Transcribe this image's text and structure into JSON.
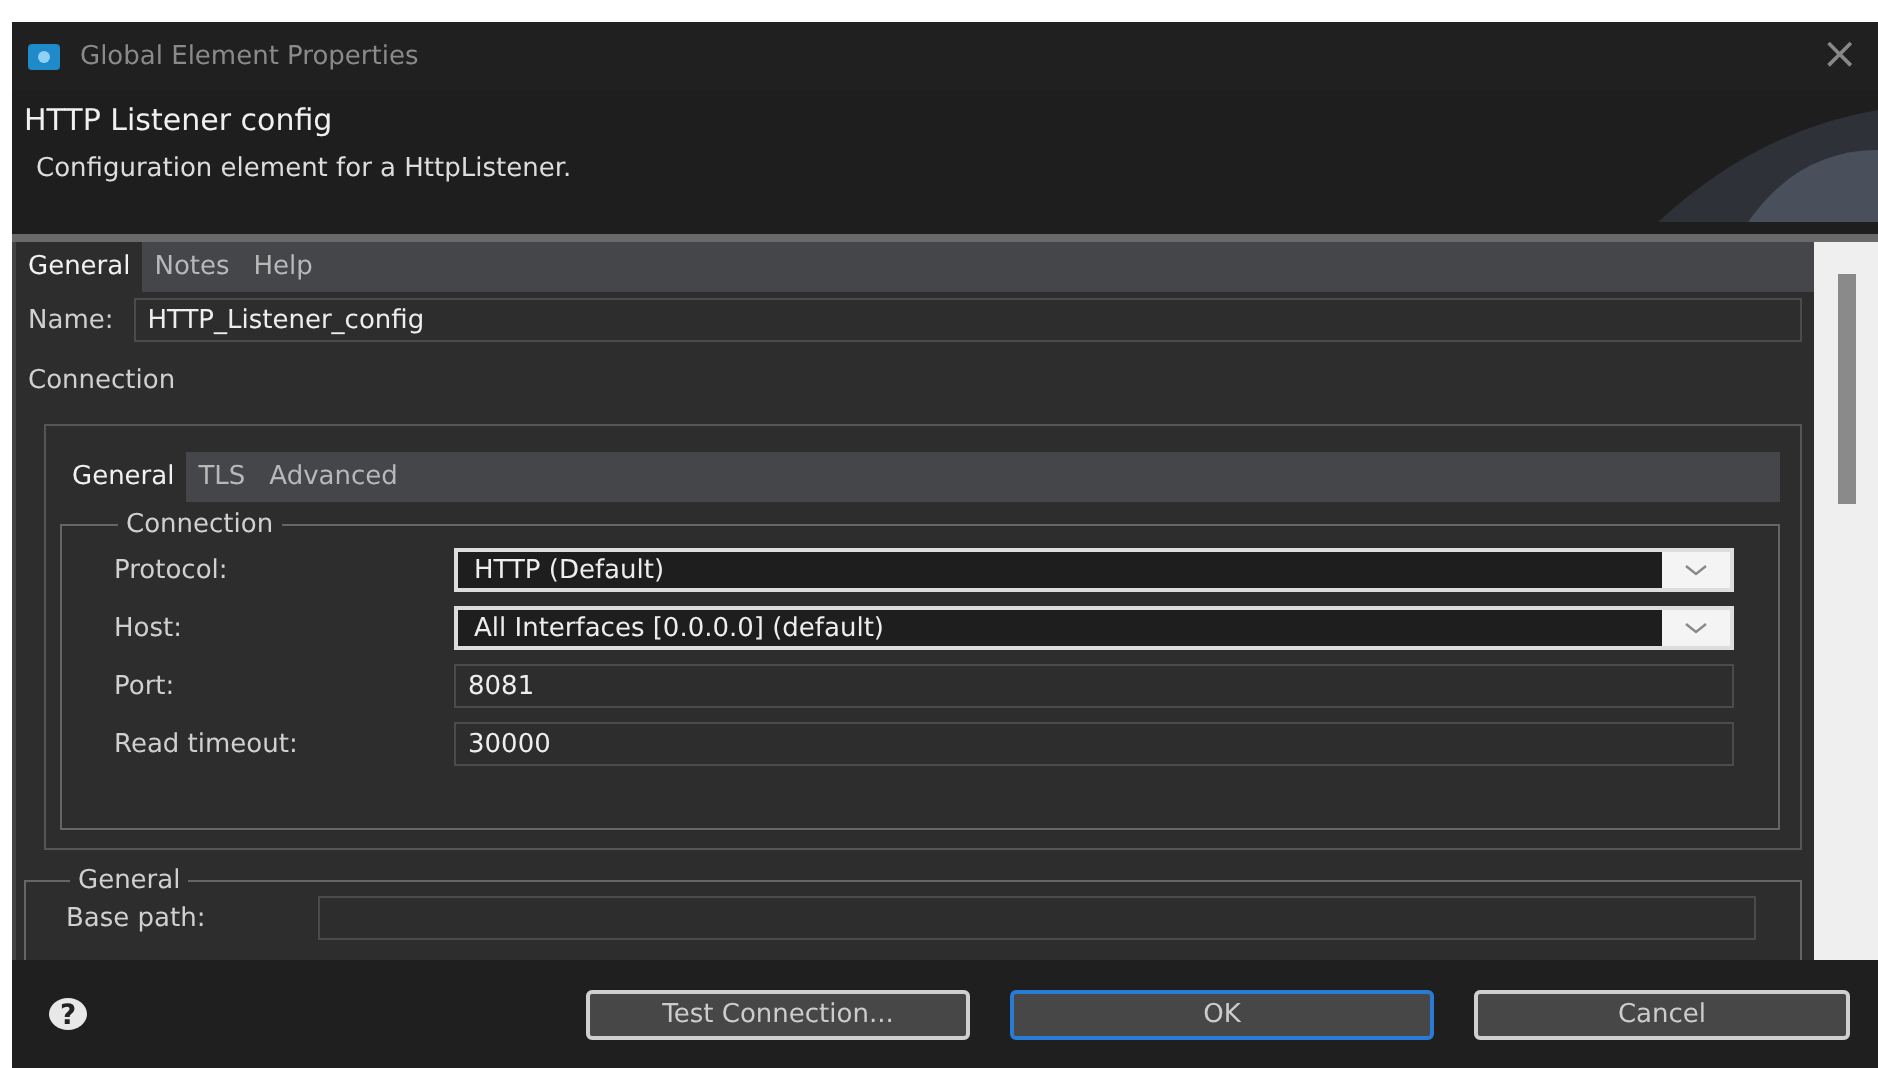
{
  "window": {
    "title": "Global Element Properties",
    "close": "×"
  },
  "header": {
    "title": "HTTP Listener config",
    "description": "Configuration element for a HttpListener."
  },
  "tabs": [
    {
      "label": "General",
      "selected": true
    },
    {
      "label": "Notes",
      "selected": false
    },
    {
      "label": "Help",
      "selected": false
    }
  ],
  "name_field": {
    "label": "Name:",
    "value": "HTTP_Listener_config"
  },
  "section_label": "Connection",
  "inner_tabs": [
    {
      "label": "General",
      "selected": true
    },
    {
      "label": "TLS",
      "selected": false
    },
    {
      "label": "Advanced",
      "selected": false
    }
  ],
  "connection_group": {
    "legend": "Connection",
    "fields": [
      {
        "kind": "dropdown",
        "label": "Protocol:",
        "value": "HTTP (Default)"
      },
      {
        "kind": "dropdown",
        "label": "Host:",
        "value": "All Interfaces [0.0.0.0] (default)"
      },
      {
        "kind": "text",
        "label": "Port:",
        "value": "8081"
      },
      {
        "kind": "text",
        "label": "Read timeout:",
        "value": "30000"
      }
    ]
  },
  "general_group": {
    "legend": "General",
    "fields": [
      {
        "kind": "text",
        "label": "Base path:"
      }
    ]
  },
  "help": "?",
  "buttons": [
    {
      "label": "Test Connection...",
      "focused": false
    },
    {
      "label": "OK",
      "focused": true
    },
    {
      "label": "Cancel",
      "focused": false
    }
  ]
}
